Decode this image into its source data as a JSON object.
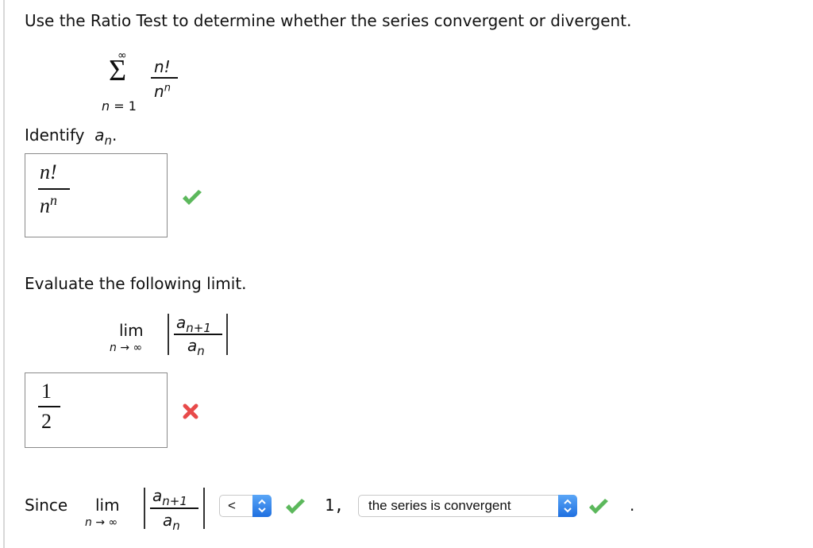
{
  "question": {
    "prompt": "Use the Ratio Test to determine whether the series convergent or divergent.",
    "series": {
      "sum_upper": "∞",
      "sum_lower": "n = 1",
      "numerator": "n!",
      "denominator_base": "n",
      "denominator_exp": "n"
    }
  },
  "part1": {
    "label": "Identify",
    "label_var": "a",
    "label_sub": "n",
    "label_end": ".",
    "answer": {
      "numerator": "n!",
      "denominator_base": "n",
      "denominator_exp": "n"
    },
    "status": "correct",
    "status_icon": "check-icon"
  },
  "part2": {
    "label": "Evaluate the following limit.",
    "limit": {
      "lim": "lim",
      "under": "n → ∞",
      "num_var": "a",
      "num_sub": "n+1",
      "den_var": "a",
      "den_sub": "n"
    },
    "answer": {
      "numerator": "1",
      "denominator": "2"
    },
    "status": "incorrect",
    "status_icon": "x-icon"
  },
  "part3": {
    "since": "Since",
    "limit": {
      "lim": "lim",
      "under": "n → ∞",
      "num_var": "a",
      "num_sub": "n+1",
      "den_var": "a",
      "den_sub": "n"
    },
    "comparison_select": {
      "value": "<",
      "status": "correct"
    },
    "one": "1,",
    "conclusion_select": {
      "value": "the series is convergent",
      "status": "correct"
    },
    "period": "."
  },
  "colors": {
    "check": "#5cb85c",
    "cross": "#e84a4a",
    "select_arrow": "#2a7ae8",
    "box_border": "#8a8a8a"
  }
}
